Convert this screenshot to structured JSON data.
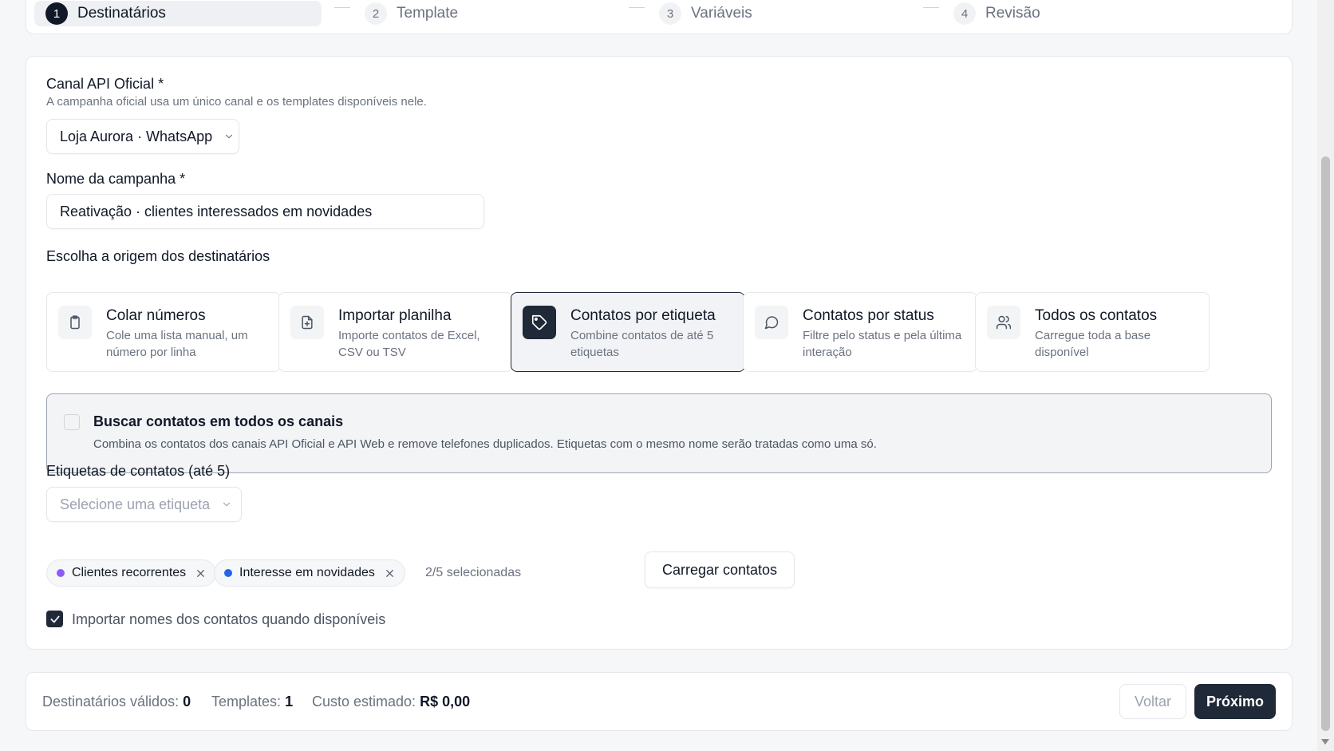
{
  "steps": [
    {
      "num": "1",
      "label": "Destinatários"
    },
    {
      "num": "2",
      "label": "Template"
    },
    {
      "num": "3",
      "label": "Variáveis"
    },
    {
      "num": "4",
      "label": "Revisão"
    }
  ],
  "channel": {
    "label": "Canal API Oficial *",
    "hint": "A campanha oficial usa um único canal e os templates disponíveis nele.",
    "value": "Loja Aurora · WhatsApp"
  },
  "campaign": {
    "label": "Nome da campanha *",
    "value": "Reativação · clientes interessados em novidades"
  },
  "origin": {
    "label": "Escolha a origem dos destinatários",
    "options": [
      {
        "title": "Colar números",
        "desc": "Cole uma lista manual, um número por linha",
        "icon": "clipboard-icon"
      },
      {
        "title": "Importar planilha",
        "desc": "Importe contatos de Excel, CSV ou TSV",
        "icon": "file-plus-icon"
      },
      {
        "title": "Contatos por etiqueta",
        "desc": "Combine contatos de até 5 etiquetas",
        "icon": "tag-icon"
      },
      {
        "title": "Contatos por status",
        "desc": "Filtre pelo status e pela última interação",
        "icon": "chat-bubble-icon"
      },
      {
        "title": "Todos os contatos",
        "desc": "Carregue toda a base disponível",
        "icon": "users-icon"
      }
    ]
  },
  "all_channels": {
    "title": "Buscar contatos em todos os canais",
    "desc": "Combina os contatos dos canais API Oficial e API Web e remove telefones duplicados. Etiquetas com o mesmo nome serão tratadas como uma só."
  },
  "tags": {
    "label": "Etiquetas de contatos (até 5)",
    "placeholder": "Selecione uma etiqueta",
    "selected": [
      {
        "name": "Clientes recorrentes",
        "color": "#8b5cf6"
      },
      {
        "name": "Interesse em novidades",
        "color": "#2563eb"
      }
    ],
    "count": "2/5 selecionadas",
    "load_button": "Carregar contatos"
  },
  "import_names": "Importar nomes dos contatos quando disponíveis",
  "footer": {
    "valid_label": "Destinatários válidos:",
    "valid_value": "0",
    "templates_label": "Templates:",
    "templates_value": "1",
    "cost_label": "Custo estimado:",
    "cost_value": "R$ 0,00",
    "back": "Voltar",
    "next": "Próximo"
  }
}
